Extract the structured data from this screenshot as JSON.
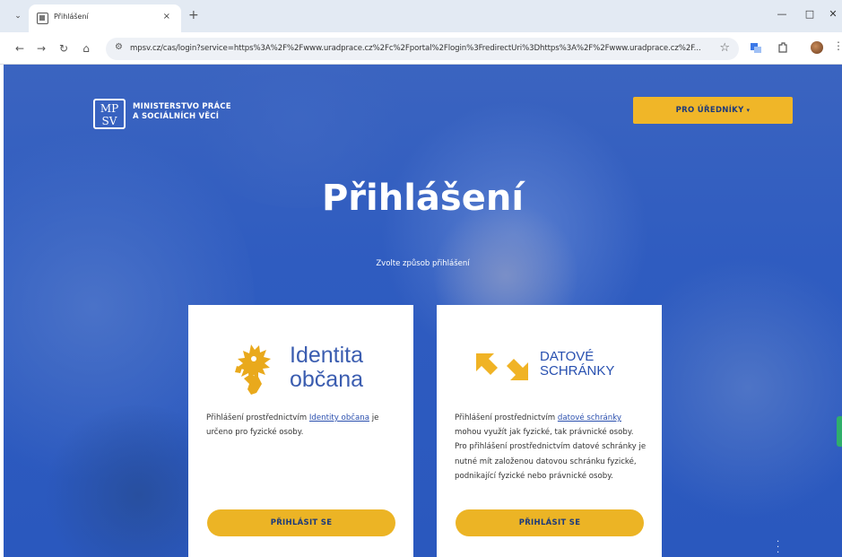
{
  "browser": {
    "tab_title": "Přihlášení",
    "tab_close": "×",
    "new_tab": "+",
    "url": "mpsv.cz/cas/login?service=https%3A%2F%2Fwww.uradprace.cz%2Fc%2Fportal%2Flogin%3FredirectUri%3Dhttps%3A%2F%2Fwww.uradprace.cz%2F...",
    "nav": {
      "back": "←",
      "forward": "→",
      "reload": "↻",
      "home": "⌂"
    },
    "window_controls": {
      "minimize": "—",
      "maximize": "□",
      "close": "✕"
    },
    "bookmark_icon": "star-icon"
  },
  "header": {
    "logo_mark": "MP SV",
    "org_name_line1": "MINISTERSTVO PRÁCE",
    "org_name_line2": "A SOCIÁLNÍCH VĚCÍ",
    "officials_button": "PRO ÚŘEDNÍKY",
    "officials_caret": "▾"
  },
  "main": {
    "title": "Přihlášení",
    "subtitle": "Zvolte způsob přihlášení"
  },
  "cards": [
    {
      "brand_line1": "Identita",
      "brand_line2": "občana",
      "desc_before": "Přihlášení prostřednictvím ",
      "desc_link": "Identity občana",
      "desc_after": " je určeno pro fyzické osoby.",
      "button": "PŘIHLÁSIT SE"
    },
    {
      "brand_line1": "DATOVÉ",
      "brand_line2": "SCHRÁNKY",
      "desc_before": "Přihlášení prostřednictvím ",
      "desc_link": "datové schránky",
      "desc_after": " mohou využít jak fyzické, tak právnické osoby. Pro přihlášení prostřednictvím datové schránky je nutné mít založenou datovou schránku fyzické, podnikající fyzické nebo právnické osoby.",
      "button": "PŘIHLÁSIT SE"
    }
  ],
  "colors": {
    "accent_yellow": "#ecb425",
    "page_blue": "#2f5cc0",
    "button_text": "#1d3a7a"
  }
}
